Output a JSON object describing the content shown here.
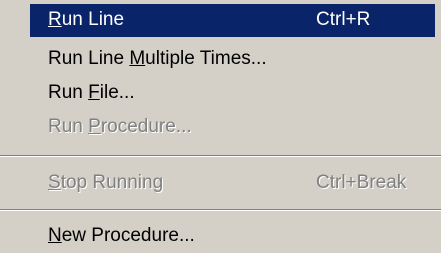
{
  "menu": {
    "items": [
      {
        "pre": "",
        "accel": "R",
        "post": "un Line",
        "shortcut": "Ctrl+R"
      },
      {
        "pre": "Run Line ",
        "accel": "M",
        "post": "ultiple Times...",
        "shortcut": ""
      },
      {
        "pre": "Run ",
        "accel": "F",
        "post": "ile...",
        "shortcut": ""
      },
      {
        "pre": "Run ",
        "accel": "P",
        "post": "rocedure...",
        "shortcut": ""
      },
      {
        "pre": "",
        "accel": "S",
        "post": "top Running",
        "shortcut": "Ctrl+Break"
      },
      {
        "pre": "",
        "accel": "N",
        "post": "ew Procedure...",
        "shortcut": ""
      }
    ]
  },
  "colors": {
    "menu_background": "#d4d0c8",
    "highlight": "#0a246a",
    "disabled_text": "#808080"
  }
}
